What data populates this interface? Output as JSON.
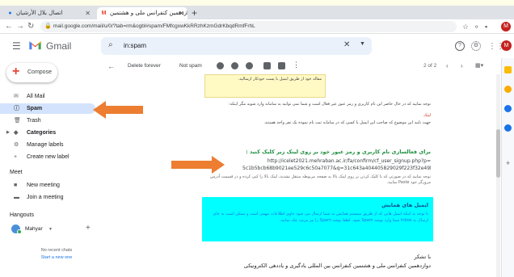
{
  "browser": {
    "tabs": [
      {
        "title": "اتصال بلال الأرشيان",
        "active": false
      },
      {
        "title": "دوازدهمین کنفرانس ملی و هشتمین",
        "active": true
      }
    ],
    "url": "mail.google.com/mail/u/0/?tab=rm&ogbl#spam/FMfcgxwKkRRzhKzmGdrKbqdRmfFrhL",
    "profile_initial": "M"
  },
  "gmail": {
    "app_name": "Gmail",
    "search_value": "in:spam",
    "avatar_initial": "M",
    "compose_label": "Compose",
    "nav": [
      {
        "label": "All Mail",
        "icon": "all-mail-icon",
        "active": false,
        "bold": false
      },
      {
        "label": "Spam",
        "icon": "spam-icon",
        "active": true,
        "bold": true
      },
      {
        "label": "Trash",
        "icon": "trash-icon",
        "active": false,
        "bold": false
      },
      {
        "label": "Categories",
        "icon": "label-icon",
        "active": false,
        "bold": true
      },
      {
        "label": "Manage labels",
        "icon": "gear-icon",
        "active": false,
        "bold": false
      },
      {
        "label": "Create new label",
        "icon": "plus-icon",
        "active": false,
        "bold": false
      }
    ],
    "meet_title": "Meet",
    "meet_items": [
      "New meeting",
      "Join a meeting"
    ],
    "hangouts_title": "Hangouts",
    "hangouts_user": "Mahyar",
    "no_chats": "No recent chats",
    "start_new": "Start a new one",
    "toolbar": {
      "delete_forever": "Delete forever",
      "not_spam": "Not spam",
      "page_count": "2 of 2"
    }
  },
  "message": {
    "note_box": "مقاله خود از طریق ایمیل با پست خودکار ارسالید.",
    "para1": "توجه نمایید که در حال حاضر این نام کاربری و رمز عبور غیر فعال است و شما نمی توانید به سامانه وارد شوید مگر اینکه:",
    "para1_red": "لینک",
    "para2": "جهت تایید این موضوع که صاحب این ایمیل یا کسی که در سامانه ثبت نام نموده یک نفر واحد هستند.",
    "green_title": "برای فعالسازی نام کاربری و رمز عبور خود بر روی لینک زیر کلیک کنید :",
    "link1": "http://icelet2021.mehraban.ac.ir/fa/confirm/cf_user_signup.php?p=",
    "link2": "5c1b5bcb68b9021ee529c6c50a7077&q=31c643a404405829029f223f32e49bdc=fa",
    "link_note": "توجه نمایید که در صورتی که با کلیک کردن بر روی لینک بالا به صفحه مربوطه منتقل نشدید، لینک بالا را کپی کرده و در قسمت آدرس مرورگر خود Paste نمایید.",
    "hl_title": "ایمیل های همایش",
    "hl_text": "با توجه به اینکه ایمیل هایی که از طریق سیستم همایش به شما ارسال می شود حاوی اطلاعات مهمی است و ممکن است به جای ارسال به Inbox شما وارد پوشه Spam شود، لطفا پوشه Spam را نیز مرتب چک نمایید.",
    "sig1": "با تشکر",
    "sig2": "دوازدهمین کنفرانس ملی و هشتمین کنفرانس بین المللی یادگیری و یاددهی الکترونیکی"
  },
  "colors": {
    "arrow": "#ed7d31",
    "highlight": "#00ffff",
    "spam_active": "#d3e3fd",
    "green_title": "#1e8e3e"
  }
}
